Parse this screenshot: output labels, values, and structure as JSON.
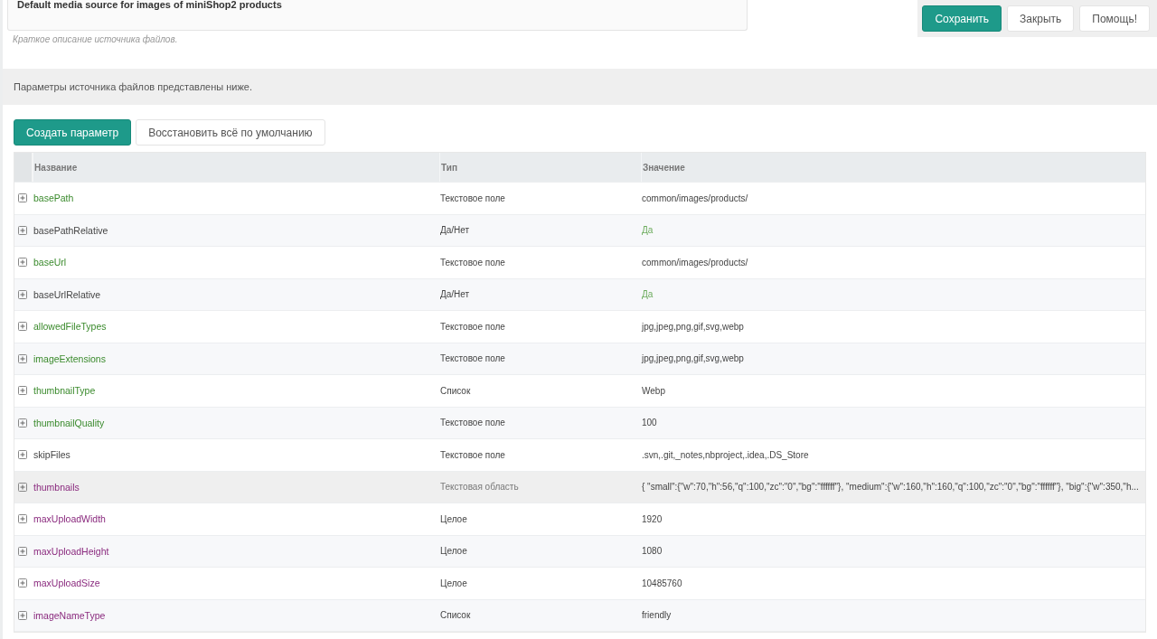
{
  "description": {
    "value": "Default media source for images of miniShop2 products",
    "hint": "Краткое описание источника файлов."
  },
  "actions": [
    {
      "label": "Сохранить",
      "primary": true
    },
    {
      "label": "Закрыть",
      "primary": false
    },
    {
      "label": "Помощь!",
      "primary": false
    }
  ],
  "notice": "Параметры источника файлов представлены ниже.",
  "toolbar": [
    {
      "label": "Создать параметр",
      "primary": true
    },
    {
      "label": "Восстановить всё по умолчанию",
      "primary": false
    }
  ],
  "table": {
    "columns": [
      "Название",
      "Тип",
      "Значение"
    ],
    "rows": [
      {
        "name": "basePath",
        "type": "Текстовое поле",
        "value": "common/images/products/",
        "color": "#3a8a2c",
        "kind": "text",
        "selected": false
      },
      {
        "name": "basePathRelative",
        "type": "Да/Нет",
        "value": "Да",
        "color": "#444444",
        "kind": "boolean",
        "selected": false
      },
      {
        "name": "baseUrl",
        "type": "Текстовое поле",
        "value": "common/images/products/",
        "color": "#3a8a2c",
        "kind": "text",
        "selected": false
      },
      {
        "name": "baseUrlRelative",
        "type": "Да/Нет",
        "value": "Да",
        "color": "#444444",
        "kind": "boolean",
        "selected": false
      },
      {
        "name": "allowedFileTypes",
        "type": "Текстовое поле",
        "value": "jpg,jpeg,png,gif,svg,webp",
        "color": "#3a8a2c",
        "kind": "text",
        "selected": false
      },
      {
        "name": "imageExtensions",
        "type": "Текстовое поле",
        "value": "jpg,jpeg,png,gif,svg,webp",
        "color": "#3a8a2c",
        "kind": "text",
        "selected": false
      },
      {
        "name": "thumbnailType",
        "type": "Список",
        "value": "Webp",
        "color": "#3a8a2c",
        "kind": "text",
        "selected": false
      },
      {
        "name": "thumbnailQuality",
        "type": "Текстовое поле",
        "value": "100",
        "color": "#3a8a2c",
        "kind": "text",
        "selected": false
      },
      {
        "name": "skipFiles",
        "type": "Текстовое поле",
        "value": ".svn,.git,_notes,nbproject,.idea,.DS_Store",
        "color": "#444444",
        "kind": "text",
        "selected": false
      },
      {
        "name": "thumbnails",
        "type": "Текстовая область",
        "value": "{ \"small\":{\"w\":70,\"h\":56,\"q\":100,\"zc\":\"0\",\"bg\":\"ffffff\"}, \"medium\":{\"w\":160,\"h\":160,\"q\":100,\"zc\":\"0\",\"bg\":\"ffffff\"}, \"big\":{\"w\":350,\"h...",
        "color": "#8a2a7e",
        "kind": "text",
        "selected": true
      },
      {
        "name": "maxUploadWidth",
        "type": "Целое",
        "value": "1920",
        "color": "#8a2a7e",
        "kind": "text",
        "selected": false
      },
      {
        "name": "maxUploadHeight",
        "type": "Целое",
        "value": "1080",
        "color": "#8a2a7e",
        "kind": "text",
        "selected": false
      },
      {
        "name": "maxUploadSize",
        "type": "Целое",
        "value": "10485760",
        "color": "#8a2a7e",
        "kind": "text",
        "selected": false
      },
      {
        "name": "imageNameType",
        "type": "Список",
        "value": "friendly",
        "color": "#8a2a7e",
        "kind": "text",
        "selected": false
      }
    ]
  }
}
